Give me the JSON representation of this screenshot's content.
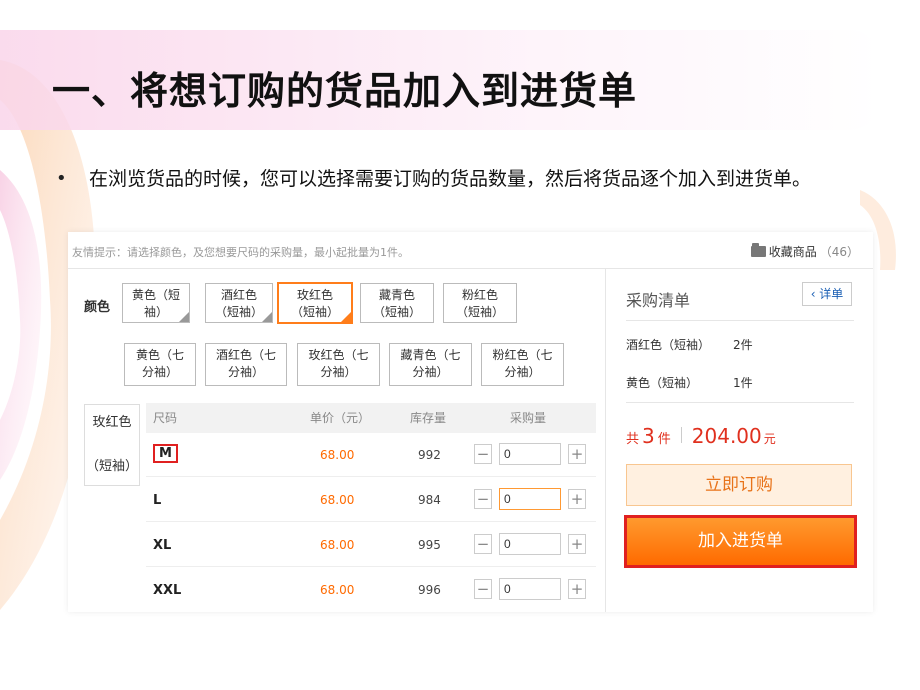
{
  "slide": {
    "title": "一、将想订购的货品加入到进货单",
    "bullet": "•",
    "bullet_text": "在浏览货品的时候，您可以选择需要订购的货品数量，然后将货品逐个加入到进货单。"
  },
  "panel": {
    "hint": "友情提示：请选择颜色，及您想要尺码的采购量，最小起批量为1件。",
    "favorite": {
      "label": "收藏商品",
      "count": "（46）",
      "icon": "folder-icon"
    },
    "color_label": "颜色",
    "colors_short": [
      {
        "l1": "黄色（短",
        "l2": "袖）"
      },
      {
        "l1": "酒红色",
        "l2": "（短袖）"
      },
      {
        "l1": "玫红色",
        "l2": "（短袖）"
      },
      {
        "l1": "藏青色",
        "l2": "（短袖）"
      },
      {
        "l1": "粉红色",
        "l2": "（短袖）"
      }
    ],
    "colors_long": [
      {
        "l1": "黄色（七",
        "l2": "分袖）"
      },
      {
        "l1": "酒红色（七",
        "l2": "分袖）"
      },
      {
        "l1": "玫红色（七",
        "l2": "分袖）"
      },
      {
        "l1": "藏青色（七",
        "l2": "分袖）"
      },
      {
        "l1": "粉红色（七",
        "l2": "分袖）"
      }
    ],
    "selected_color": {
      "l1": "玫红色",
      "l2": "（短袖）"
    },
    "table": {
      "headers": {
        "size": "尺码",
        "price": "单价（元）",
        "stock": "库存量",
        "qty": "采购量"
      },
      "rows": [
        {
          "size": "M",
          "price": "68.00",
          "stock": "992",
          "qty": "0"
        },
        {
          "size": "L",
          "price": "68.00",
          "stock": "984",
          "qty": "0"
        },
        {
          "size": "XL",
          "price": "68.00",
          "stock": "995",
          "qty": "0"
        },
        {
          "size": "XXL",
          "price": "68.00",
          "stock": "996",
          "qty": "0"
        }
      ],
      "minus": "−",
      "plus": "+"
    },
    "cart": {
      "title": "采购清单",
      "detail": "‹ 详单",
      "items": [
        {
          "name": "酒红色（短袖）",
          "qty": "2件"
        },
        {
          "name": "黄色（短袖）",
          "qty": "1件"
        }
      ],
      "total_prefix": "共",
      "total_count": "3",
      "total_unit": "件",
      "total_amount": "204.00",
      "currency": "元",
      "buy_now": "立即订购",
      "add_to_list": "加入进货单"
    }
  },
  "colors": {
    "accent": "#ff6a00",
    "highlight_border": "#e02020",
    "link": "#1a5fb4"
  }
}
